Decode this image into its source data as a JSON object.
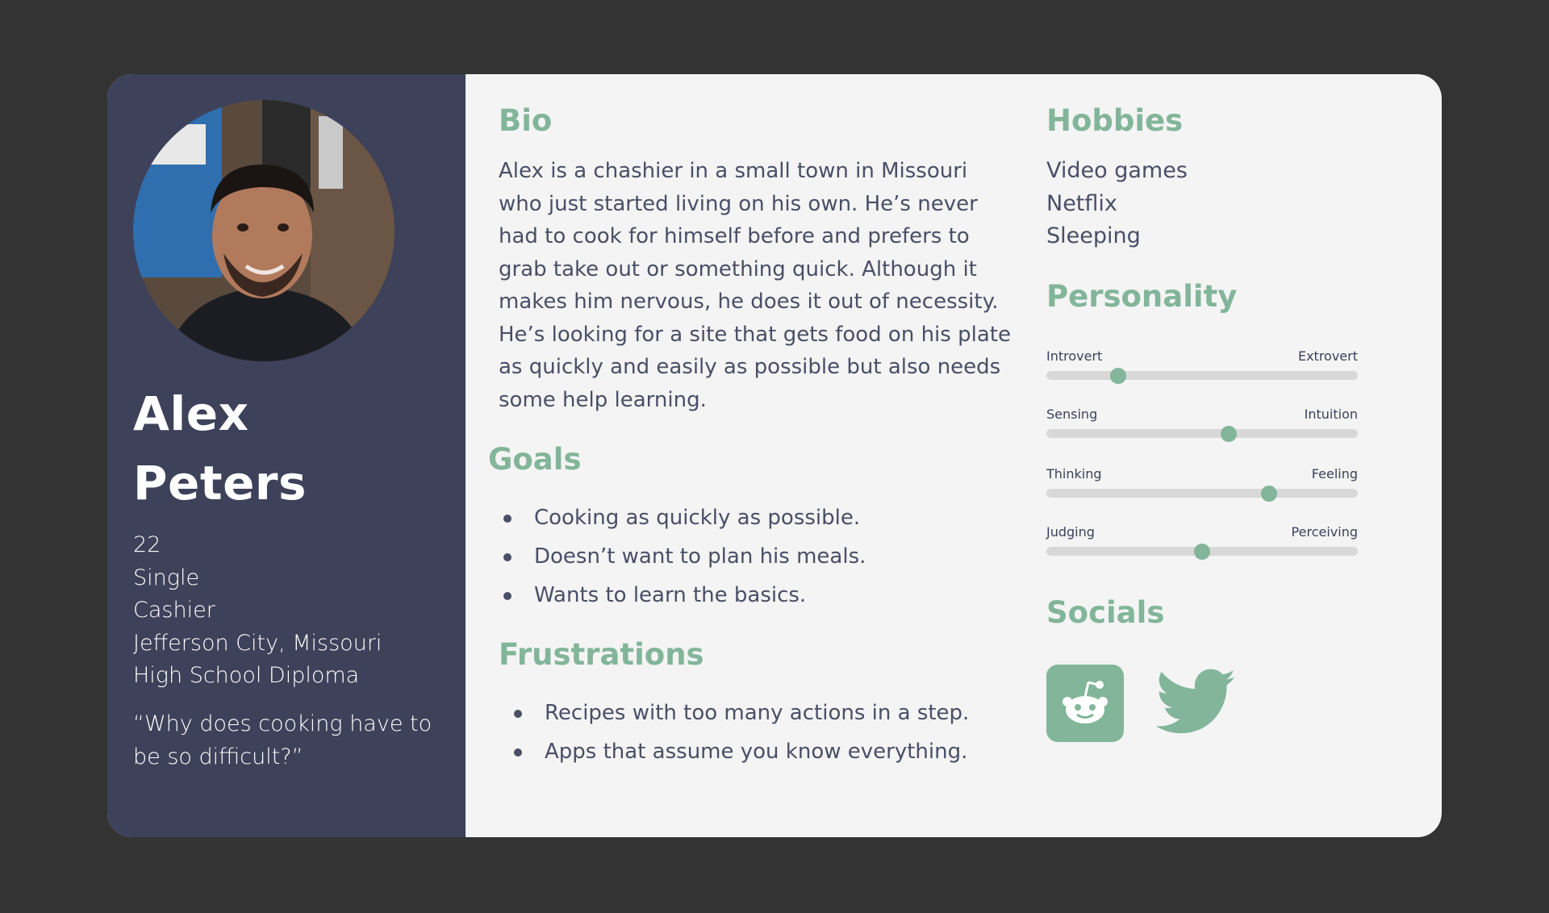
{
  "person": {
    "first_name": "Alex",
    "last_name": "Peters",
    "age": "22",
    "status": "Single",
    "occupation": "Cashier",
    "location": "Jefferson City, Missouri",
    "education": "High School Diploma",
    "quote": "“Why does cooking have to be so difficult?”"
  },
  "bio": {
    "heading": "Bio",
    "text": "Alex is a chashier in a small town in Missouri who just started living on his own. He’s never had to cook for himself before and prefers to grab take out or something quick. Although it makes him nervous, he does it out of necessity. He’s looking for a site that gets food on his plate as quickly and easily as possible but also needs some help learning."
  },
  "goals": {
    "heading": "Goals",
    "items": [
      "Cooking as quickly as possible.",
      "Doesn’t want to plan his meals.",
      "Wants to learn the basics."
    ]
  },
  "frustrations": {
    "heading": "Frustrations",
    "items": [
      "Recipes with too many actions in a step.",
      "Apps that assume you know everything."
    ]
  },
  "hobbies": {
    "heading": "Hobbies",
    "items": [
      "Video games",
      "Netflix",
      "Sleeping"
    ]
  },
  "personality": {
    "heading": "Personality",
    "traits": [
      {
        "left": "Introvert",
        "right": "Extrovert",
        "value": 0.23
      },
      {
        "left": "Sensing",
        "right": "Intuition",
        "value": 0.585
      },
      {
        "left": "Thinking",
        "right": "Feeling",
        "value": 0.715
      },
      {
        "left": "Judging",
        "right": "Perceiving",
        "value": 0.5
      }
    ]
  },
  "socials": {
    "heading": "Socials",
    "icons": [
      "reddit-icon",
      "twitter-icon"
    ]
  },
  "colors": {
    "accent": "#82b599",
    "sidebar": "#3d4159",
    "card": "#f4f4f4",
    "background": "#333333"
  }
}
